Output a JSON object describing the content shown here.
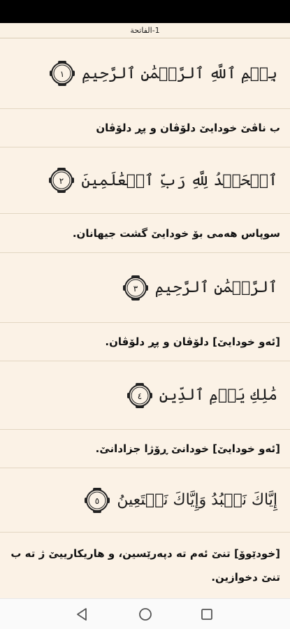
{
  "header": {
    "title": "1-الفاتحة"
  },
  "verses": [
    {
      "arabic": "بِسۡمِ ٱللَّهِ ٱلرَّحۡمَٰنِ ٱلرَّحِيمِ",
      "number": "١",
      "translation": "ب ناڤێ خودایێ دلۆڤان و پڕ دلۆڤان"
    },
    {
      "arabic": "ٱلۡحَمۡدُ لِلَّهِ رَبِّ ٱلۡعَٰلَمِينَ",
      "number": "٢",
      "translation": "سوپاس هەمی بۆ خودایێ گشت جیهانان."
    },
    {
      "arabic": "ٱلرَّحۡمَٰنِ ٱلرَّحِيمِ",
      "number": "٣",
      "translation": "[ئەو خودایێ] دلۆڤان و پڕ دلۆڤان."
    },
    {
      "arabic": "مَٰلِكِ يَوۡمِ ٱلدِّينِ",
      "number": "٤",
      "translation": "[ئەو خودایێ] خودانێ ڕۆژا جزادانێ."
    },
    {
      "arabic": "إِيَّاكَ نَعۡبُدُ وَإِيَّاكَ نَسۡتَعِينُ",
      "number": "٥",
      "translation": "[خودێوۆ] تنێ ئەم تە دپەرێسین، و هاریکارییێ ژ تە ب تنێ دخوازین."
    }
  ],
  "nav": {
    "back": "back-triangle",
    "home": "home-circle",
    "recents": "recents-square"
  }
}
